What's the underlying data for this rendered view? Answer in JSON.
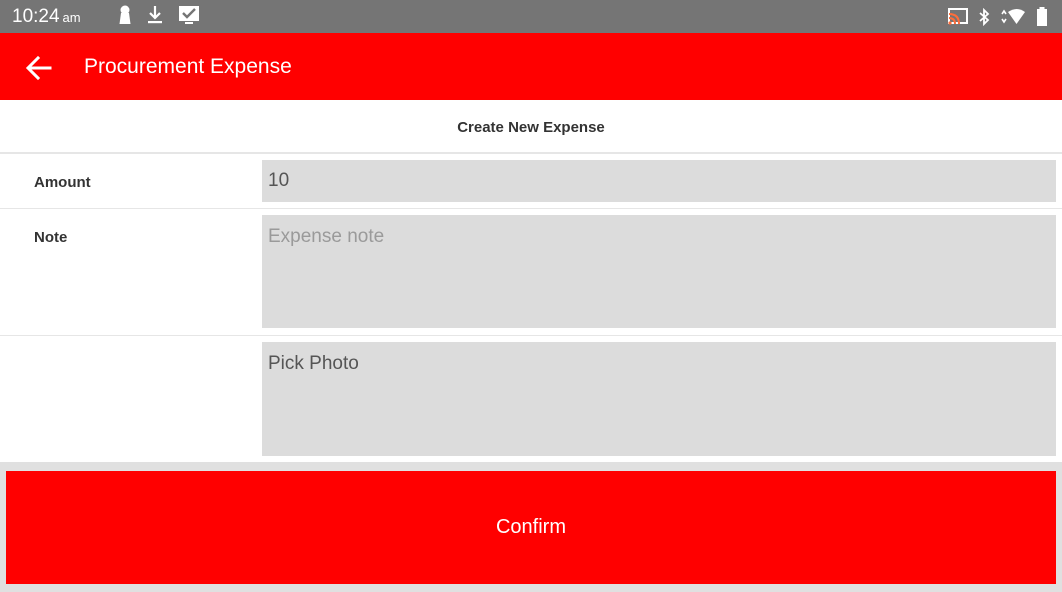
{
  "status_bar": {
    "time": "10:24",
    "ampm": "am"
  },
  "app_bar": {
    "title": "Procurement Expense"
  },
  "form": {
    "header": "Create New Expense",
    "amount_label": "Amount",
    "amount_value": "10",
    "note_label": "Note",
    "note_placeholder": "Expense note",
    "photo_label": "Pick Photo"
  },
  "actions": {
    "confirm_label": "Confirm"
  },
  "colors": {
    "accent": "#ff0000",
    "status_bar": "#757575",
    "field_bg": "#dcdcdc"
  }
}
